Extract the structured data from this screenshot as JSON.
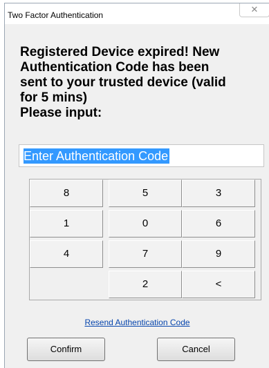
{
  "window": {
    "title": "Two Factor Authentication",
    "close_glyph": "✕"
  },
  "message": {
    "lines": [
      "Registered Device expired! New",
      "Authentication Code has been",
      "sent to your trusted device (valid",
      "for 5 mins)",
      "Please input:"
    ]
  },
  "code_input": {
    "value": "Enter Authentication Code",
    "selected": true
  },
  "keypad": {
    "keys": [
      "8",
      "5",
      "3",
      "1",
      "0",
      "6",
      "4",
      "7",
      "9",
      "2",
      "<"
    ]
  },
  "resend_link": "Resend Authentication Code",
  "buttons": {
    "confirm": "Confirm",
    "cancel": "Cancel"
  },
  "colors": {
    "selection": "#3399ff",
    "link": "#0645ad",
    "dialog_background": "#f0f0f0"
  }
}
